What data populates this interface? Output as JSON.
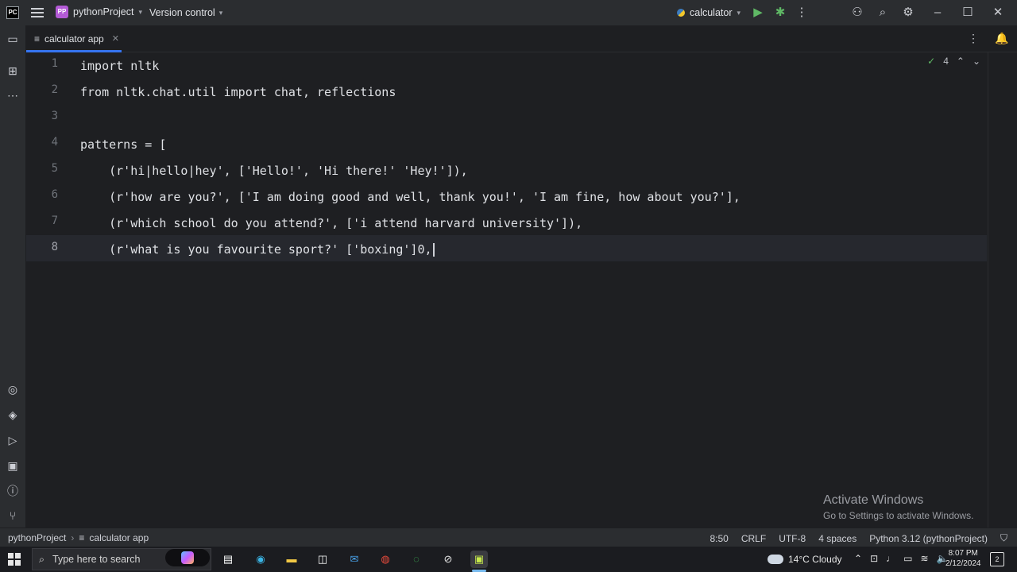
{
  "titlebar": {
    "project_badge": "PP",
    "project_name": "pythonProject",
    "version_control": "Version control",
    "run_config": "calculator"
  },
  "tab": {
    "label": "calculator app"
  },
  "inspections": {
    "count": "4"
  },
  "editor": {
    "current_line": 8,
    "lines": [
      {
        "num": "1",
        "text": "import nltk"
      },
      {
        "num": "2",
        "text": "from nltk.chat.util import chat, reflections"
      },
      {
        "num": "3",
        "text": ""
      },
      {
        "num": "4",
        "text": "patterns = ["
      },
      {
        "num": "5",
        "text": "    (r'hi|hello|hey', ['Hello!', 'Hi there!' 'Hey!']),"
      },
      {
        "num": "6",
        "text": "    (r'how are you?', ['I am doing good and well, thank you!', 'I am fine, how about you?'],"
      },
      {
        "num": "7",
        "text": "    (r'which school do you attend?', ['i attend harvard university']),"
      },
      {
        "num": "8",
        "text": "    (r'what is you favourite sport?' ['boxing']0,"
      }
    ]
  },
  "watermark": {
    "title": "Activate Windows",
    "subtitle": "Go to Settings to activate Windows."
  },
  "statusbar": {
    "project": "pythonProject",
    "file": "calculator app",
    "position": "8:50",
    "line_sep": "CRLF",
    "encoding": "UTF-8",
    "indent": "4 spaces",
    "interpreter": "Python 3.12 (pythonProject)"
  },
  "taskbar": {
    "search_placeholder": "Type here to search",
    "weather": "14°C  Cloudy",
    "time": "8:07 PM",
    "date": "2/12/2024",
    "notifications": "2"
  },
  "colors": {
    "accent": "#3574f0",
    "run": "#5fb865",
    "project_badge": "#b35ad6"
  }
}
